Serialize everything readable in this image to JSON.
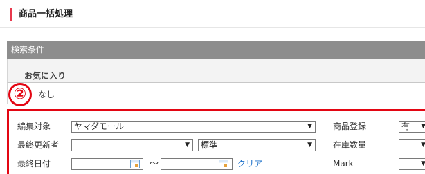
{
  "page": {
    "title": "商品一括処理"
  },
  "search": {
    "header_label": "検索条件"
  },
  "favorites": {
    "label": "お気に入り",
    "value": "なし"
  },
  "annotation": {
    "step_marker": "②"
  },
  "filters": {
    "edit_target": {
      "label": "編集対象",
      "value": "ヤマダモール"
    },
    "last_updater": {
      "label": "最終更新者",
      "value": "",
      "type_value": "標準"
    },
    "last_date": {
      "label": "最終日付",
      "from": "",
      "to": "",
      "separator": "～",
      "clear_label": "クリア"
    },
    "product_registration": {
      "label": "商品登録",
      "value": "有"
    },
    "stock_quantity": {
      "label": "在庫数量",
      "value": ""
    },
    "mark": {
      "label": "Mark",
      "value": ""
    }
  },
  "colors": {
    "accent": "#e8394d",
    "highlight": "#e30613",
    "header_bar": "#8d8d8d",
    "link": "#1a6fc9"
  },
  "icons": {
    "dropdown": "chevron-down-icon",
    "calendar": "calendar-icon"
  }
}
